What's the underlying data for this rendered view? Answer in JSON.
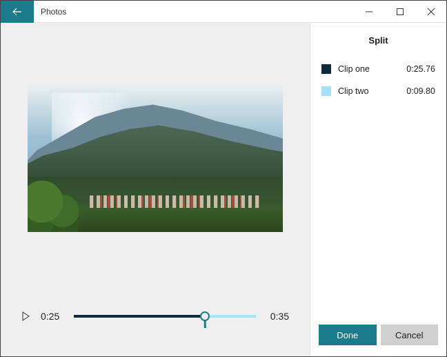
{
  "window": {
    "title": "Photos"
  },
  "panel": {
    "title": "Split"
  },
  "clips": [
    {
      "name": "Clip one",
      "duration": "0:25.76",
      "swatch_class": "sw-dark"
    },
    {
      "name": "Clip two",
      "duration": "0:09.80",
      "swatch_class": "sw-light"
    }
  ],
  "timeline": {
    "current": "0:25",
    "total": "0:35",
    "split_percent": 72
  },
  "buttons": {
    "done": "Done",
    "cancel": "Cancel"
  }
}
